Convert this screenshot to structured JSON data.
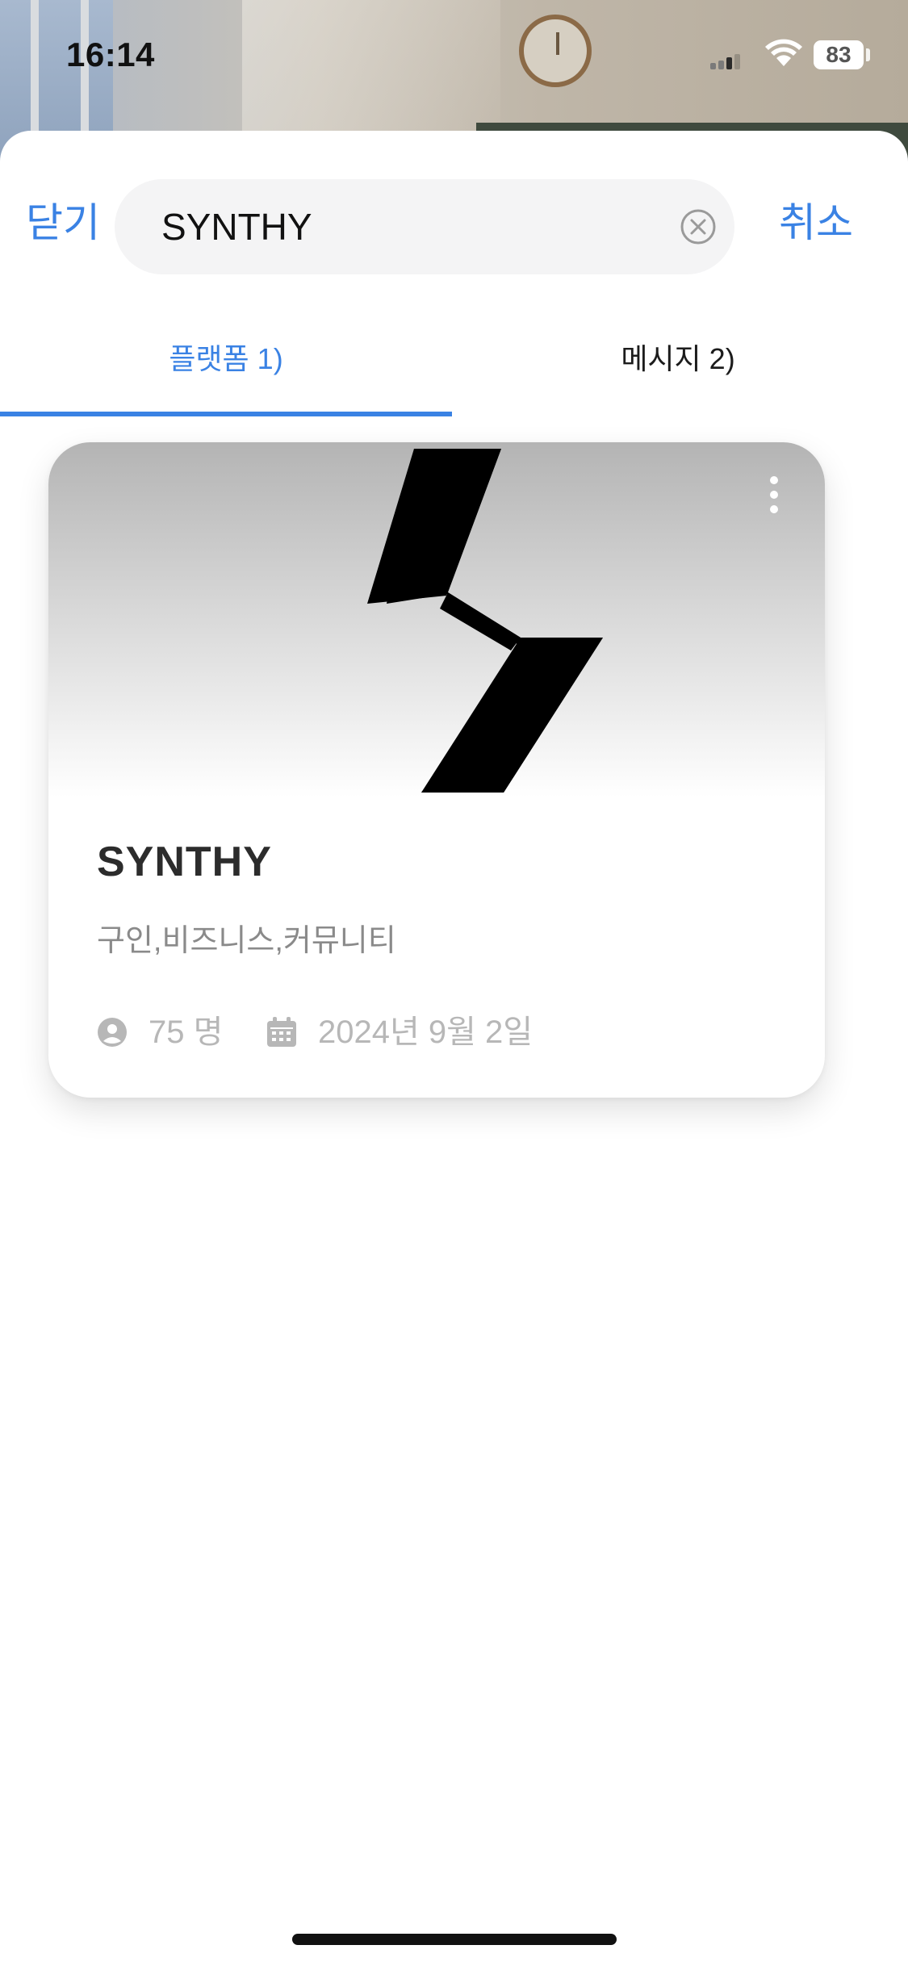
{
  "status_bar": {
    "time": "16:14",
    "battery": "83"
  },
  "header": {
    "close_label": "닫기",
    "search_value": "SYNTHY",
    "cancel_label": "취소"
  },
  "tabs": [
    {
      "label": "플랫폼 1)",
      "active": true
    },
    {
      "label": "메시지 2)",
      "active": false
    }
  ],
  "card": {
    "title": "SYNTHY",
    "tags": "구인,비즈니스,커뮤니티",
    "members": "75 명",
    "date": "2024년 9월 2일"
  },
  "colors": {
    "accent": "#3a82e4",
    "meta": "#b7b7b7"
  },
  "icons": [
    "signal-icon",
    "wifi-icon",
    "battery-icon",
    "clear-icon",
    "more-icon",
    "person-icon",
    "calendar-icon"
  ]
}
